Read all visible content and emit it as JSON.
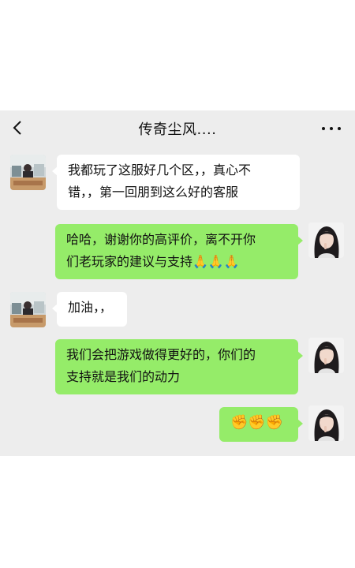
{
  "header": {
    "title": "传奇尘风....",
    "back_icon": "chevron-left-icon",
    "more_icon": "ellipsis-icon"
  },
  "messages": [
    {
      "side": "in",
      "lines": [
        "我都玩了这服好几个区，，真心不",
        "错，，第一回朋到这么好的客服"
      ]
    },
    {
      "side": "out",
      "lines": [
        "哈哈，谢谢你的高评价，离不开你",
        "们老玩家的建议与支持🙏🙏🙏"
      ]
    },
    {
      "side": "in",
      "lines": [
        "加油，，"
      ]
    },
    {
      "side": "out",
      "lines": [
        "我们会把游戏做得更好的，你们的",
        "支持就是我们的动力"
      ]
    },
    {
      "side": "out",
      "lines": [
        "✊✊✊"
      ]
    }
  ],
  "colors": {
    "chat_background": "#ededed",
    "incoming_bubble": "#ffffff",
    "outgoing_bubble": "#95ec69"
  }
}
